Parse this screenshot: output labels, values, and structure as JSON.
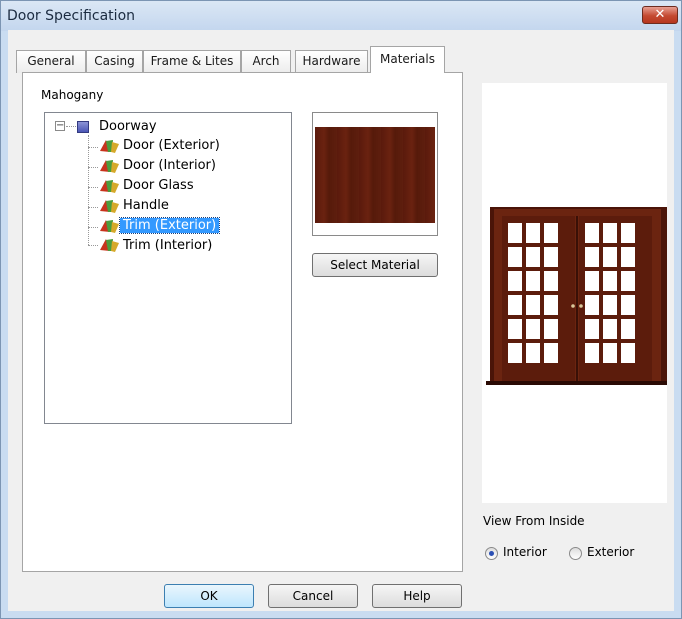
{
  "window": {
    "title": "Door Specification",
    "close_glyph": "✕"
  },
  "tabs": [
    {
      "label": "General"
    },
    {
      "label": "Casing"
    },
    {
      "label": "Frame & Lites"
    },
    {
      "label": "Arch"
    },
    {
      "label": "Hardware"
    },
    {
      "label": "Materials",
      "active": true
    }
  ],
  "materials": {
    "current_material": "Mahogany",
    "tree": {
      "root": "Doorway",
      "items": [
        {
          "label": "Door (Exterior)"
        },
        {
          "label": "Door (Interior)"
        },
        {
          "label": "Door Glass"
        },
        {
          "label": "Handle"
        },
        {
          "label": "Trim (Exterior)",
          "selected": true
        },
        {
          "label": "Trim (Interior)"
        }
      ]
    },
    "select_material_label": "Select Material",
    "swatch_color": "#5e1e0e"
  },
  "preview": {
    "view_label": "View From Inside",
    "options": [
      {
        "label": "Interior",
        "checked": true
      },
      {
        "label": "Exterior",
        "checked": false
      }
    ],
    "door_color": "#5a1a0c"
  },
  "buttons": {
    "ok": "OK",
    "cancel": "Cancel",
    "help": "Help"
  }
}
